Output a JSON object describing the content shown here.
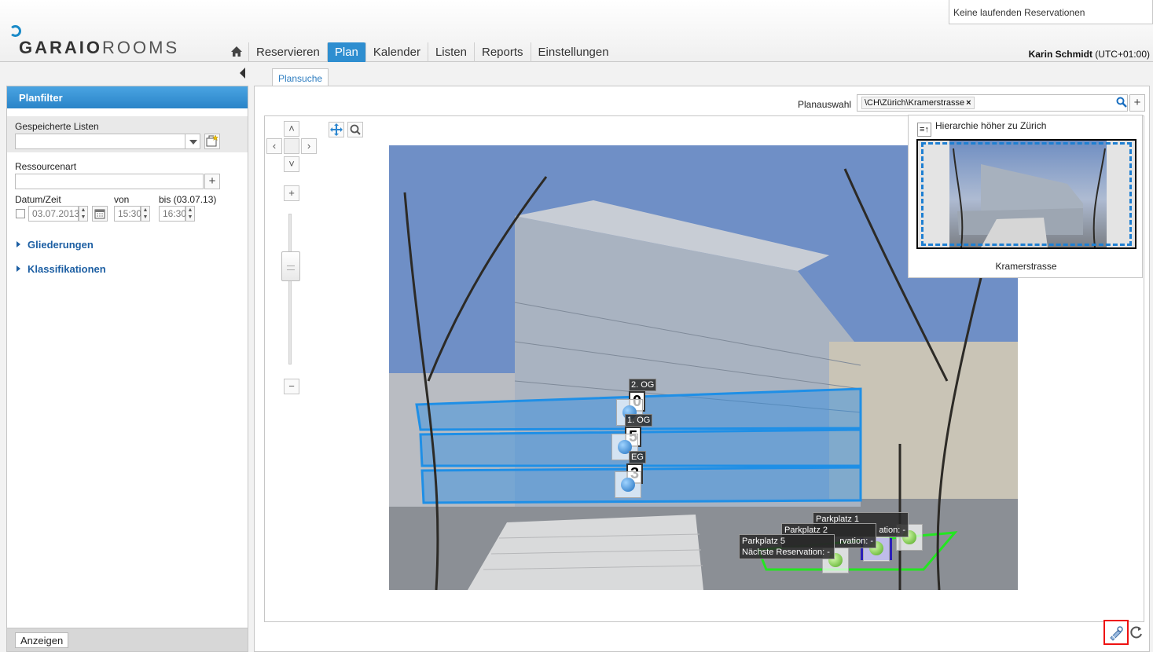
{
  "header": {
    "notice": "Keine laufenden Reservationen",
    "brand_a": "GARAIO",
    "brand_b": "ROOMS",
    "user_name": "Karin Schmidt",
    "timezone": "(UTC+01:00)"
  },
  "nav": {
    "home_icon": "home-icon",
    "items": [
      {
        "label": "Reservieren"
      },
      {
        "label": "Plan"
      },
      {
        "label": "Kalender"
      },
      {
        "label": "Listen"
      },
      {
        "label": "Reports"
      },
      {
        "label": "Einstellungen"
      }
    ],
    "active": "Plan",
    "accent": "#2e8ed0"
  },
  "sidebar": {
    "title": "Planfilter",
    "saved_lists_label": "Gespeicherte Listen",
    "saved_lists_value": "",
    "resource_type_label": "Ressourcenart",
    "resource_type_value": "",
    "datetime_label": "Datum/Zeit",
    "from_label": "von",
    "to_label": "bis (03.07.13)",
    "date_value": "03.07.2013",
    "from_value": "15:30",
    "to_value": "16:30",
    "sections": [
      {
        "label": "Gliederungen"
      },
      {
        "label": "Klassifikationen"
      }
    ],
    "show_button": "Anzeigen"
  },
  "main": {
    "tab": "Plansuche",
    "plan_select_label": "Planauswahl",
    "plan_token": "\\CH\\Zürich\\Kramerstrasse",
    "plan_token_remove": "×",
    "floors": [
      {
        "label": "2. OG",
        "count": "0"
      },
      {
        "label": "1. OG",
        "count": "5"
      },
      {
        "label": "EG",
        "count": "3"
      }
    ],
    "parking": [
      {
        "name": "Parkplatz 1",
        "next": "ation: -"
      },
      {
        "name": "Parkplatz 2",
        "next": "rvation: -"
      },
      {
        "name": "Parkplatz 5",
        "next": "Nächste Reservation: -"
      }
    ],
    "overview": {
      "up_label": "Hierarchie höher zu Zürich",
      "name": "Kramerstrasse"
    }
  }
}
